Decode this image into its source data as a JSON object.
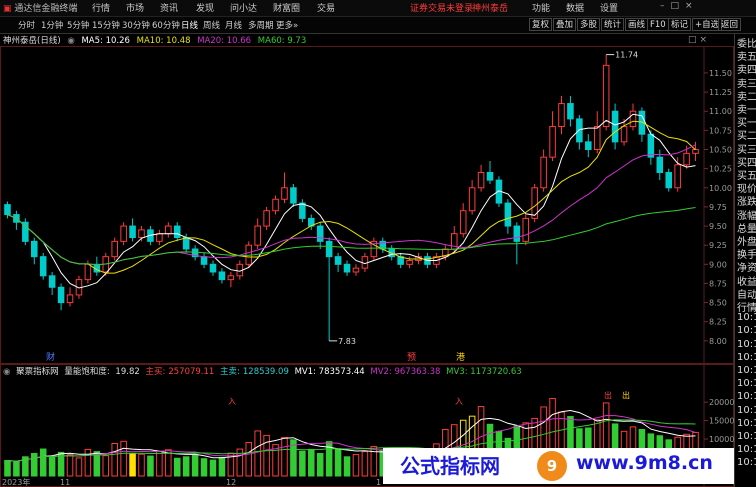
{
  "topbar": {
    "brand": "通达信金融终端",
    "menu": [
      "行情",
      "市场",
      "资讯",
      "发现",
      "问小达",
      "财富圈",
      "交易"
    ],
    "alert": "证券交易未登录",
    "alert2": "神州泰岳",
    "funcs": [
      "功能",
      "数据",
      "设置"
    ]
  },
  "periods": [
    "分时",
    "1分钟",
    "5分钟",
    "15分钟",
    "30分钟",
    "60分钟",
    "日线",
    "周线",
    "月线",
    "多周期",
    "更多"
  ],
  "active_period": "日线",
  "right_tools": [
    "复权",
    "叠加",
    "多股",
    "统计",
    "画线",
    "F10",
    "标记",
    "+自选"
  ],
  "right_tools2": [
    "返回"
  ],
  "info": {
    "title": "神州泰岳(日线)",
    "ma5": "MA5: 10.26",
    "ma10": "MA10: 10.48",
    "ma20": "MA20: 10.66",
    "ma60": "MA60: 9.73",
    "colors": {
      "ma5": "#ffffff",
      "ma10": "#e8e000",
      "ma20": "#cc33cc",
      "ma60": "#33cc33"
    }
  },
  "right_panel": [
    "委比",
    "卖五",
    "卖四",
    "卖三",
    "卖二",
    "卖一",
    "买一",
    "买二",
    "买三",
    "买四",
    "买五",
    "现价",
    "涨跌",
    "涨幅",
    "总量",
    "外盘",
    "换手",
    "净资",
    "收益",
    "自动",
    "行情",
    "10:1",
    "10:1",
    "10:1",
    "10:1",
    "10:1",
    "10:1",
    "10:1",
    "10:1",
    "10:1",
    "10:1",
    "10:1",
    "10:1"
  ],
  "price_axis": [
    "11.50",
    "11.25",
    "11.00",
    "10.75",
    "10.50",
    "10.25",
    "10.00",
    "9.75",
    "9.50",
    "9.25",
    "9.00",
    "8.75",
    "8.50",
    "8.25",
    "8.00"
  ],
  "annotations": {
    "high": "11.74",
    "low": "7.83",
    "fin": "财",
    "tou": "预",
    "gang": "港",
    "chu": "出",
    "ru": "入"
  },
  "vol_info": {
    "title": "聚票指标网",
    "title2": "量能饱和度:",
    "sat": "19.82",
    "main_buy_lbl": "主买:",
    "main_buy": "257079.11",
    "main_sell_lbl": "主卖:",
    "main_sell": "128539.09",
    "mv1": "MV1: 783573.44",
    "mv2": "MV2: 967363.38",
    "mv3": "MV3: 1173720.63"
  },
  "vol_axis": [
    "20000",
    "15000",
    "10000"
  ],
  "date_axis": [
    "2023年",
    "11",
    "12",
    "1"
  ],
  "watermark": {
    "left": "公式指标网",
    "logo": "9",
    "right": "www.9m8.cn"
  },
  "chart_data": {
    "type": "candlestick",
    "title": "神州泰岳(日线)",
    "ylim": [
      7.75,
      11.8
    ],
    "y_ticks": [
      8.0,
      8.25,
      8.5,
      8.75,
      9.0,
      9.25,
      9.5,
      9.75,
      10.0,
      10.25,
      10.5,
      10.75,
      11.0,
      11.25,
      11.5
    ],
    "high_label": 11.74,
    "low_label": 7.83,
    "candles": [
      [
        9.78,
        9.65,
        9.82,
        9.6
      ],
      [
        9.65,
        9.55,
        9.7,
        9.45
      ],
      [
        9.55,
        9.3,
        9.6,
        9.25
      ],
      [
        9.3,
        9.1,
        9.35,
        9.0
      ],
      [
        9.1,
        8.85,
        9.15,
        8.8
      ],
      [
        8.85,
        8.7,
        8.9,
        8.6
      ],
      [
        8.7,
        8.5,
        8.75,
        8.4
      ],
      [
        8.5,
        8.6,
        8.7,
        8.45
      ],
      [
        8.6,
        8.8,
        8.85,
        8.55
      ],
      [
        8.8,
        9.0,
        9.05,
        8.75
      ],
      [
        9.0,
        8.9,
        9.1,
        8.85
      ],
      [
        8.9,
        9.1,
        9.15,
        8.85
      ],
      [
        9.1,
        9.3,
        9.35,
        9.05
      ],
      [
        9.3,
        9.5,
        9.55,
        9.25
      ],
      [
        9.5,
        9.35,
        9.6,
        9.3
      ],
      [
        9.35,
        9.45,
        9.5,
        9.3
      ],
      [
        9.45,
        9.3,
        9.5,
        9.25
      ],
      [
        9.3,
        9.4,
        9.45,
        9.25
      ],
      [
        9.4,
        9.5,
        9.55,
        9.35
      ],
      [
        9.5,
        9.35,
        9.55,
        9.3
      ],
      [
        9.35,
        9.2,
        9.4,
        9.15
      ],
      [
        9.2,
        9.1,
        9.25,
        9.05
      ],
      [
        9.1,
        9.0,
        9.15,
        8.95
      ],
      [
        9.0,
        8.9,
        9.05,
        8.85
      ],
      [
        8.9,
        8.8,
        8.95,
        8.75
      ],
      [
        8.8,
        8.85,
        8.9,
        8.7
      ],
      [
        8.85,
        9.0,
        9.05,
        8.8
      ],
      [
        9.0,
        9.25,
        9.3,
        8.95
      ],
      [
        9.25,
        9.5,
        9.6,
        9.2
      ],
      [
        9.5,
        9.7,
        9.75,
        9.45
      ],
      [
        9.7,
        9.85,
        9.9,
        9.65
      ],
      [
        9.85,
        10.0,
        10.2,
        9.8
      ],
      [
        10.0,
        9.8,
        10.05,
        9.75
      ],
      [
        9.8,
        9.6,
        9.85,
        9.55
      ],
      [
        9.6,
        9.5,
        9.65,
        9.45
      ],
      [
        9.5,
        9.3,
        9.55,
        9.2
      ],
      [
        9.3,
        9.1,
        9.35,
        8.0
      ],
      [
        9.1,
        9.0,
        9.15,
        8.9
      ],
      [
        9.0,
        8.9,
        9.05,
        8.85
      ],
      [
        8.9,
        8.95,
        9.0,
        8.85
      ],
      [
        8.95,
        9.1,
        9.15,
        8.9
      ],
      [
        9.1,
        9.3,
        9.35,
        9.05
      ],
      [
        9.3,
        9.2,
        9.35,
        9.15
      ],
      [
        9.2,
        9.1,
        9.25,
        9.05
      ],
      [
        9.1,
        9.0,
        9.15,
        8.95
      ],
      [
        9.0,
        9.05,
        9.1,
        8.95
      ],
      [
        9.05,
        9.1,
        9.15,
        9.0
      ],
      [
        9.1,
        9.0,
        9.15,
        8.95
      ],
      [
        9.0,
        9.1,
        9.15,
        8.95
      ],
      [
        9.1,
        9.2,
        9.25,
        9.05
      ],
      [
        9.2,
        9.4,
        9.5,
        9.15
      ],
      [
        9.4,
        9.7,
        9.8,
        9.35
      ],
      [
        9.7,
        10.0,
        10.1,
        9.65
      ],
      [
        10.0,
        10.2,
        10.3,
        9.95
      ],
      [
        10.2,
        10.1,
        10.35,
        10.05
      ],
      [
        10.1,
        9.8,
        10.15,
        9.75
      ],
      [
        9.8,
        9.5,
        9.85,
        9.4
      ],
      [
        9.5,
        9.3,
        9.55,
        9.0
      ],
      [
        9.3,
        9.6,
        9.65,
        9.25
      ],
      [
        9.6,
        10.0,
        10.05,
        9.55
      ],
      [
        10.0,
        10.4,
        10.5,
        9.95
      ],
      [
        10.4,
        10.8,
        11.0,
        10.35
      ],
      [
        10.8,
        11.1,
        11.2,
        10.7
      ],
      [
        11.1,
        10.9,
        11.2,
        10.8
      ],
      [
        10.9,
        10.6,
        10.95,
        10.5
      ],
      [
        10.6,
        10.5,
        10.7,
        10.4
      ],
      [
        10.5,
        10.8,
        11.0,
        10.45
      ],
      [
        10.8,
        11.6,
        11.74,
        10.75
      ],
      [
        11.0,
        10.6,
        11.1,
        10.5
      ],
      [
        10.6,
        10.8,
        10.9,
        10.55
      ],
      [
        10.8,
        11.0,
        11.1,
        10.75
      ],
      [
        11.0,
        10.7,
        11.05,
        10.6
      ],
      [
        10.7,
        10.4,
        10.75,
        10.3
      ],
      [
        10.4,
        10.2,
        10.5,
        10.1
      ],
      [
        10.2,
        10.0,
        10.25,
        9.95
      ],
      [
        10.0,
        10.3,
        10.4,
        9.95
      ],
      [
        10.3,
        10.45,
        10.55,
        10.25
      ],
      [
        10.45,
        10.5,
        10.6,
        10.35
      ]
    ],
    "volume_ylim": [
      0,
      26000
    ],
    "volume": [
      4200,
      3800,
      5200,
      6100,
      7300,
      5100,
      6400,
      5800,
      4900,
      7200,
      6600,
      5500,
      8800,
      9400,
      6100,
      5900,
      5400,
      6700,
      7100,
      4800,
      5200,
      5600,
      4700,
      4300,
      5000,
      6200,
      7300,
      9100,
      12200,
      11000,
      8500,
      10400,
      9800,
      6700,
      7200,
      6100,
      9300,
      7400,
      5200,
      5800,
      6600,
      8000,
      7100,
      5500,
      4900,
      6100,
      5300,
      5000,
      8700,
      12600,
      13900,
      15100,
      16200,
      18800,
      14000,
      12100,
      10200,
      13600,
      14400,
      15600,
      18700,
      21000,
      17300,
      16100,
      12800,
      13000,
      15200,
      19800,
      14100,
      12100,
      13300,
      12600,
      11400,
      10900,
      9800,
      10500,
      11300,
      11800
    ]
  }
}
